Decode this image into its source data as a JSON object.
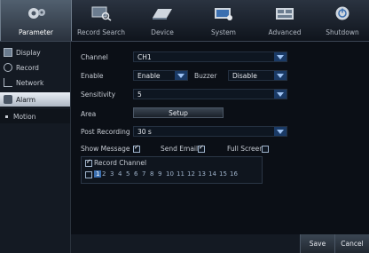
{
  "tabs": [
    {
      "label": "Parameter",
      "icon": "gears-icon",
      "active": true
    },
    {
      "label": "Record Search",
      "icon": "monitor-search-icon",
      "active": false
    },
    {
      "label": "Device",
      "icon": "disk-drive-icon",
      "active": false
    },
    {
      "label": "System",
      "icon": "system-tool-icon",
      "active": false
    },
    {
      "label": "Advanced",
      "icon": "advanced-panel-icon",
      "active": false
    },
    {
      "label": "Shutdown",
      "icon": "power-icon",
      "active": false
    }
  ],
  "sidebar": {
    "items": [
      {
        "label": "Display",
        "icon": "display-icon"
      },
      {
        "label": "Record",
        "icon": "record-icon"
      },
      {
        "label": "Network",
        "icon": "network-icon"
      },
      {
        "label": "Alarm",
        "icon": "alarm-icon",
        "active": true
      },
      {
        "label": "Motion",
        "sub": true
      }
    ]
  },
  "form": {
    "channel_label": "Channel",
    "channel_value": "CH1",
    "enable_label": "Enable",
    "enable_value": "Enable",
    "buzzer_label": "Buzzer",
    "buzzer_value": "Disable",
    "sensitivity_label": "Sensitivity",
    "sensitivity_value": "5",
    "area_label": "Area",
    "setup_button": "Setup",
    "post_recording_label": "Post Recording",
    "post_recording_value": "30 s",
    "show_message_label": "Show Message",
    "show_message_checked": true,
    "send_email_label": "Send Email",
    "send_email_checked": true,
    "full_screen_label": "Full Screen",
    "full_screen_checked": false,
    "record_channel_label": "Record Channel",
    "record_channel_checked": true,
    "channels": [
      "1",
      "2",
      "3",
      "4",
      "5",
      "6",
      "7",
      "8",
      "9",
      "10",
      "11",
      "12",
      "13",
      "14",
      "15",
      "16"
    ]
  },
  "footer": {
    "save": "Save",
    "cancel": "Cancel"
  },
  "colors": {
    "accent_blue": "#1a3a66",
    "active_tab": "#51606f"
  }
}
